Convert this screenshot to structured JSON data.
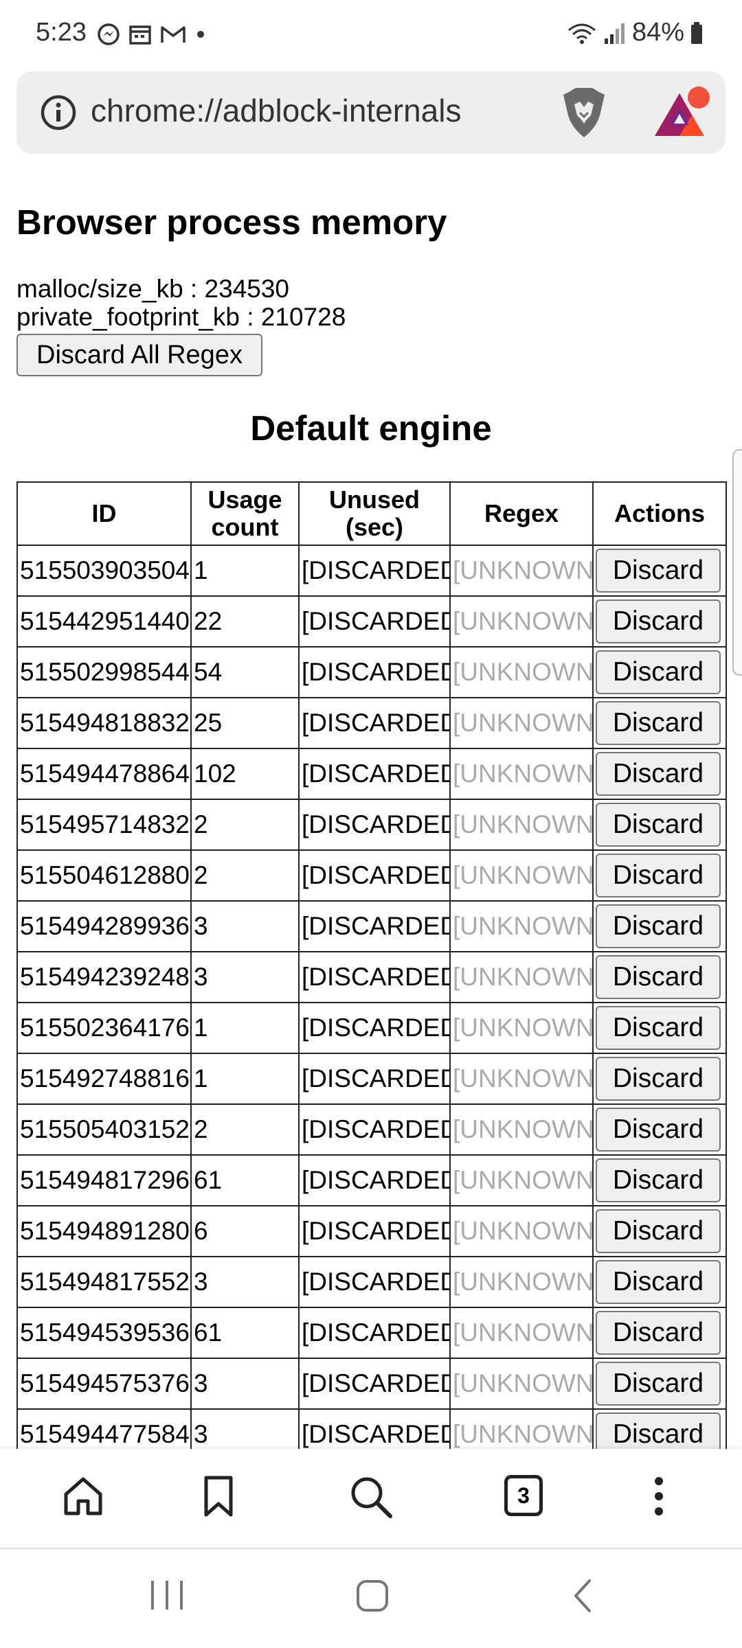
{
  "status_bar": {
    "time": "5:23",
    "battery": "84%"
  },
  "url_bar": {
    "url": "chrome://adblock-internals"
  },
  "page": {
    "memory_heading": "Browser process memory",
    "malloc_line": "malloc/size_kb : 234530",
    "private_footprint_line": "private_footprint_kb : 210728",
    "discard_all_label": "Discard All Regex",
    "engine_heading": "Default engine"
  },
  "table": {
    "headers": {
      "id": "ID",
      "usage": "Usage count",
      "unused": "Unused (sec)",
      "regex": "Regex",
      "actions": "Actions"
    },
    "rows": [
      {
        "id": "515503903504",
        "usage": "1",
        "unused": "[DISCARDED]",
        "regex": "[UNKNOWN]",
        "action": "Discard"
      },
      {
        "id": "515442951440",
        "usage": "22",
        "unused": "[DISCARDED]",
        "regex": "[UNKNOWN]",
        "action": "Discard"
      },
      {
        "id": "515502998544",
        "usage": "54",
        "unused": "[DISCARDED]",
        "regex": "[UNKNOWN]",
        "action": "Discard"
      },
      {
        "id": "515494818832",
        "usage": "25",
        "unused": "[DISCARDED]",
        "regex": "[UNKNOWN]",
        "action": "Discard"
      },
      {
        "id": "515494478864",
        "usage": "102",
        "unused": "[DISCARDED]",
        "regex": "[UNKNOWN]",
        "action": "Discard"
      },
      {
        "id": "515495714832",
        "usage": "2",
        "unused": "[DISCARDED]",
        "regex": "[UNKNOWN]",
        "action": "Discard"
      },
      {
        "id": "515504612880",
        "usage": "2",
        "unused": "[DISCARDED]",
        "regex": "[UNKNOWN]",
        "action": "Discard"
      },
      {
        "id": "515494289936",
        "usage": "3",
        "unused": "[DISCARDED]",
        "regex": "[UNKNOWN]",
        "action": "Discard"
      },
      {
        "id": "515494239248",
        "usage": "3",
        "unused": "[DISCARDED]",
        "regex": "[UNKNOWN]",
        "action": "Discard"
      },
      {
        "id": "515502364176",
        "usage": "1",
        "unused": "[DISCARDED]",
        "regex": "[UNKNOWN]",
        "action": "Discard"
      },
      {
        "id": "515492748816",
        "usage": "1",
        "unused": "[DISCARDED]",
        "regex": "[UNKNOWN]",
        "action": "Discard"
      },
      {
        "id": "515505403152",
        "usage": "2",
        "unused": "[DISCARDED]",
        "regex": "[UNKNOWN]",
        "action": "Discard"
      },
      {
        "id": "515494817296",
        "usage": "61",
        "unused": "[DISCARDED]",
        "regex": "[UNKNOWN]",
        "action": "Discard"
      },
      {
        "id": "515494891280",
        "usage": "6",
        "unused": "[DISCARDED]",
        "regex": "[UNKNOWN]",
        "action": "Discard"
      },
      {
        "id": "515494817552",
        "usage": "3",
        "unused": "[DISCARDED]",
        "regex": "[UNKNOWN]",
        "action": "Discard"
      },
      {
        "id": "515494539536",
        "usage": "61",
        "unused": "[DISCARDED]",
        "regex": "[UNKNOWN]",
        "action": "Discard"
      },
      {
        "id": "515494575376",
        "usage": "3",
        "unused": "[DISCARDED]",
        "regex": "[UNKNOWN]",
        "action": "Discard"
      },
      {
        "id": "515494477584",
        "usage": "3",
        "unused": "[DISCARDED]",
        "regex": "[UNKNOWN]",
        "action": "Discard"
      }
    ]
  },
  "toolbar": {
    "tab_count": "3",
    "icons": [
      "home-icon",
      "bookmark-icon",
      "search-icon",
      "tabs-icon",
      "more-icon"
    ]
  },
  "nav_bar": {
    "icons": [
      "recents-icon",
      "home-nav-icon",
      "back-icon"
    ]
  },
  "colors": {
    "url_bar_bg": "#eeeeee",
    "unknown_text": "#aaaaaa",
    "brave_orange": "#fb542b",
    "bat_purple": "#662d91"
  }
}
